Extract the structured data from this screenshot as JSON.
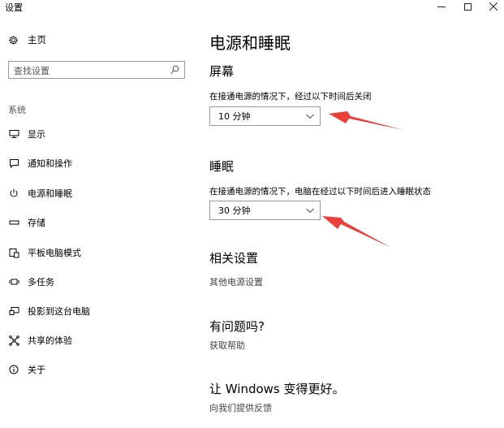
{
  "window": {
    "title": "设置",
    "minimize_icon": "minimize-icon",
    "maximize_icon": "maximize-icon",
    "close_icon": "close-icon"
  },
  "sidebar": {
    "home_label": "主页",
    "search_placeholder": "查找设置",
    "section_label": "系统",
    "items": [
      {
        "label": "显示",
        "icon": "monitor-icon"
      },
      {
        "label": "通知和操作",
        "icon": "message-icon"
      },
      {
        "label": "电源和睡眠",
        "icon": "power-icon",
        "selected": true
      },
      {
        "label": "存储",
        "icon": "storage-icon"
      },
      {
        "label": "平板电脑模式",
        "icon": "tablet-mode-icon"
      },
      {
        "label": "多任务",
        "icon": "multitask-icon"
      },
      {
        "label": "投影到这台电脑",
        "icon": "project-icon"
      },
      {
        "label": "共享的体验",
        "icon": "share-icon"
      },
      {
        "label": "关于",
        "icon": "info-icon"
      }
    ]
  },
  "main": {
    "page_title": "电源和睡眠",
    "screen": {
      "heading": "屏幕",
      "desc": "在接通电源的情况下，经过以下时间后关闭",
      "value": "10 分钟"
    },
    "sleep": {
      "heading": "睡眠",
      "desc": "在接通电源的情况下，电脑在经过以下时间后进入睡眠状态",
      "value": "30 分钟"
    },
    "related": {
      "heading": "相关设置",
      "link": "其他电源设置"
    },
    "help": {
      "heading": "有问题吗?",
      "link": "获取帮助"
    },
    "feedback": {
      "heading": "让 Windows 变得更好。",
      "link": "向我们提供反馈"
    }
  },
  "colors": {
    "annotation_arrow": "#e8413c",
    "link_text": "#444444"
  }
}
